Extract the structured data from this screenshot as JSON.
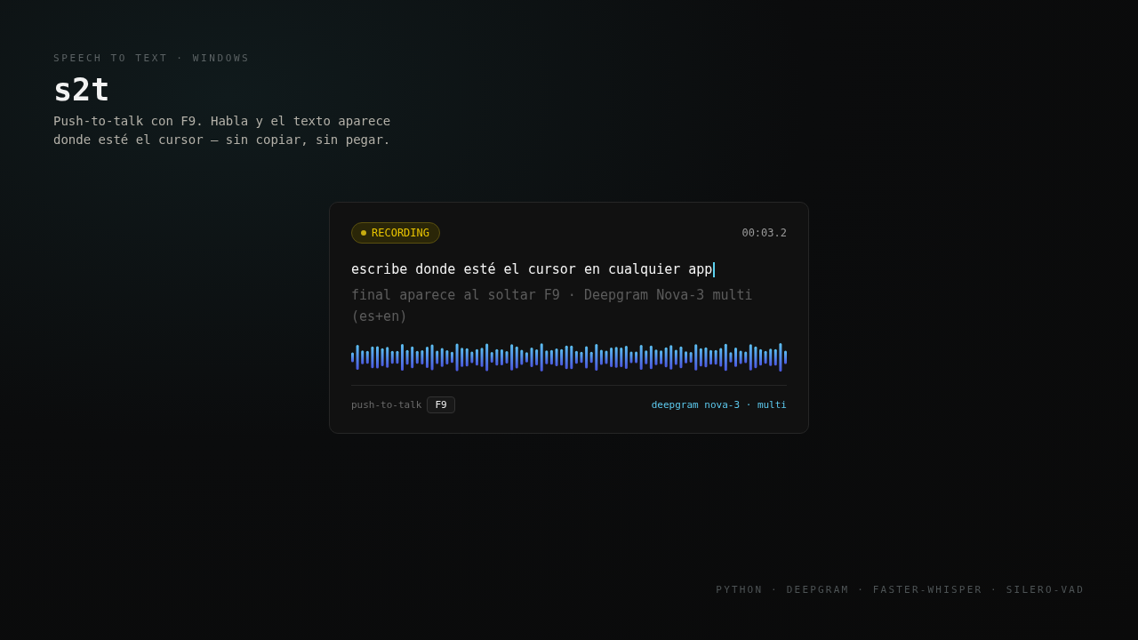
{
  "header": {
    "eyebrow": "SPEECH TO TEXT · WINDOWS",
    "title": "s2t",
    "description": "Push-to-talk con F9. Habla y el texto aparece donde esté el cursor — sin copiar, sin pegar."
  },
  "card": {
    "status": "RECORDING",
    "timer": "00:03.2",
    "transcript": "escribe donde esté el cursor en cualquier app",
    "interim": "final aparece al soltar F9 · Deepgram Nova-3 multi (es+en)",
    "hotkey_label": "push-to-talk",
    "hotkey": "F9",
    "model": "deepgram nova-3 · multi"
  },
  "footer": "PYTHON · DEEPGRAM · FASTER-WHISPER · SILERO-VAD"
}
